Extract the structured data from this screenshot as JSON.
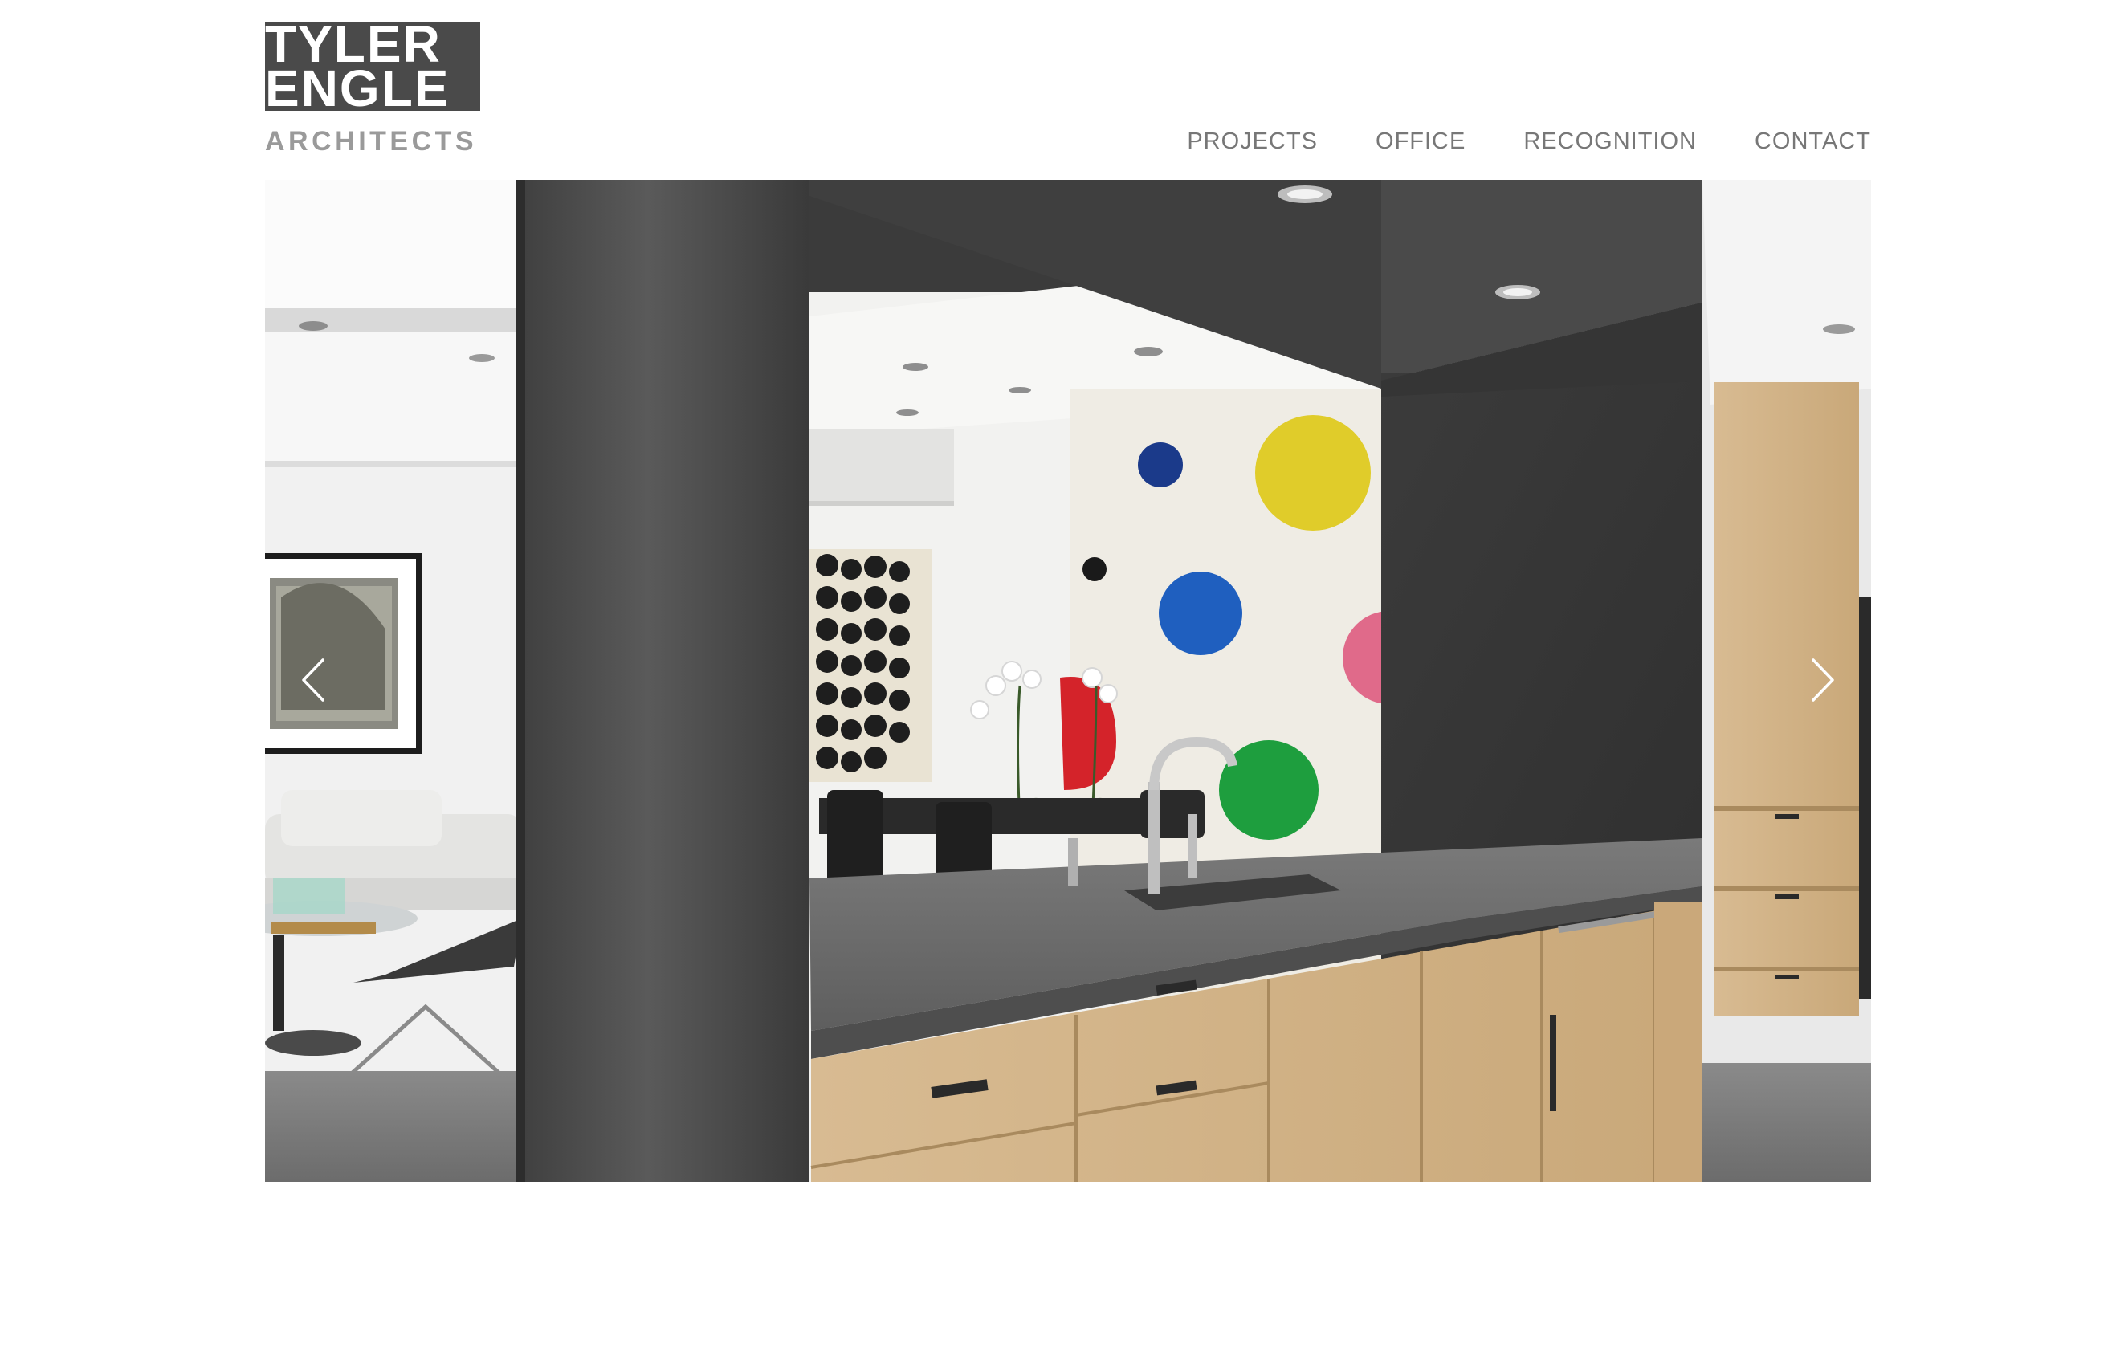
{
  "logo": {
    "line1": "TYLER",
    "line2": "ENGLE",
    "subtitle": "ARCHITECTS"
  },
  "nav": {
    "items": [
      {
        "label": "PROJECTS"
      },
      {
        "label": "OFFICE"
      },
      {
        "label": "RECOGNITION"
      },
      {
        "label": "CONTACT"
      }
    ]
  },
  "slideshow": {
    "prev_icon": "chevron-left-icon",
    "next_icon": "chevron-right-icon",
    "photo_colors": {
      "steel": "#4b4b4b",
      "wood": "#d2b48c",
      "counter": "#6f6f6f",
      "dot_yellow": "#e0cc2a",
      "dot_blue": "#1f5fbf",
      "dot_navy": "#1b3a8a",
      "dot_green": "#1e9e3e",
      "dot_red": "#d4232a",
      "dot_pink": "#e06a8a"
    }
  },
  "colors": {
    "nav_text": "#777777",
    "logo_block": "#4a4a4a",
    "logo_sub": "#9a9a9a",
    "background": "#ffffff"
  }
}
